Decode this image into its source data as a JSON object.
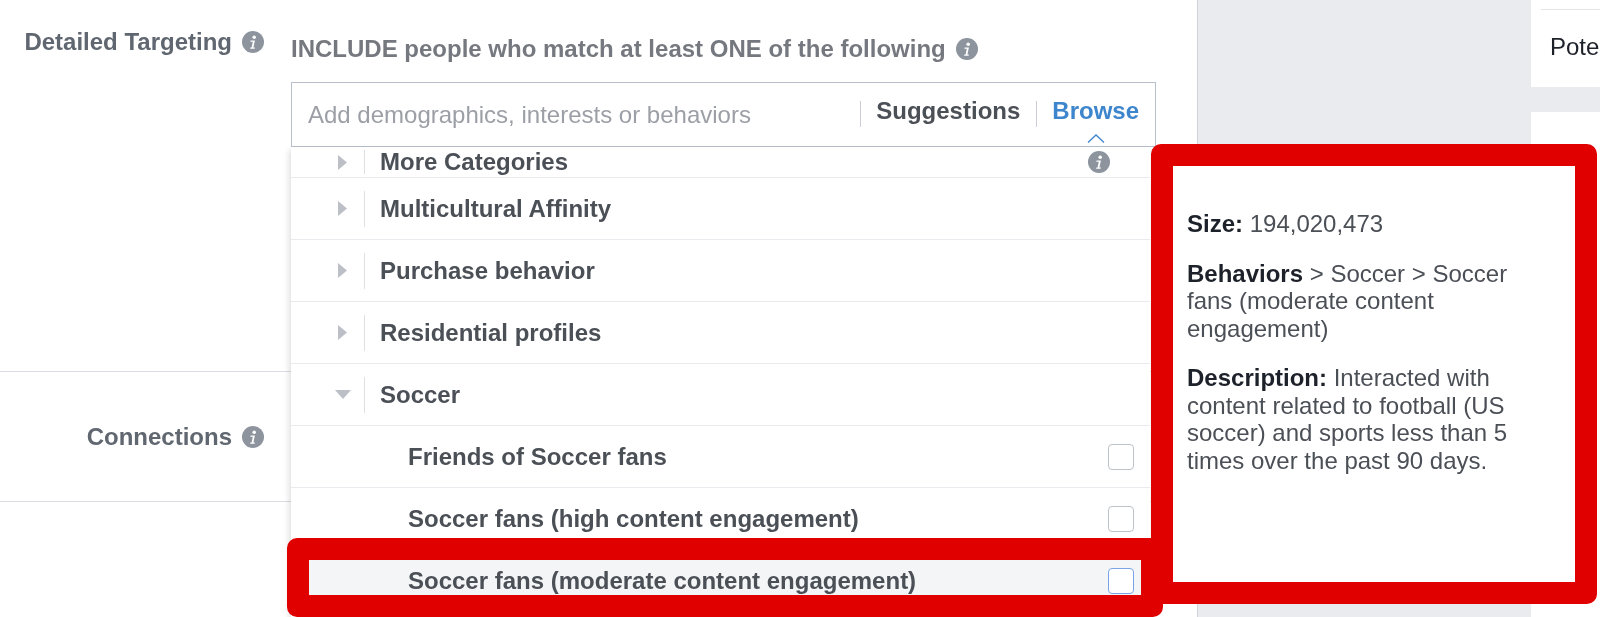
{
  "targeting": {
    "label": "Detailed Targeting",
    "heading": "INCLUDE people who match at least ONE of the following",
    "search": {
      "placeholder": "Add demographics, interests or behaviors"
    },
    "tabs": [
      {
        "label": "Suggestions",
        "selected": false
      },
      {
        "label": "Browse",
        "selected": true
      }
    ]
  },
  "browse_list": [
    {
      "label": "More Categories",
      "expanded": false,
      "info_icon": true
    },
    {
      "label": "Multicultural Affinity",
      "expanded": false,
      "info_icon": false
    },
    {
      "label": "Purchase behavior",
      "expanded": false,
      "info_icon": false
    },
    {
      "label": "Residential profiles",
      "expanded": false,
      "info_icon": false
    },
    {
      "label": "Soccer",
      "expanded": true,
      "info_icon": false,
      "children": [
        {
          "label": "Friends of Soccer fans",
          "checked": false,
          "highlighted": false,
          "outlined": false
        },
        {
          "label": "Soccer fans (high content engagement)",
          "checked": false,
          "highlighted": false,
          "outlined": false
        },
        {
          "label": "Soccer fans (moderate content engagement)",
          "checked": false,
          "highlighted": true,
          "outlined": true
        }
      ]
    }
  ],
  "connections": {
    "label": "Connections"
  },
  "tooltip": {
    "outlined": true,
    "size": "**Size:** 194,020,473",
    "path": "**Behaviors** > Soccer > Soccer fans (moderate content engagement)",
    "description": "**Description:** Interacted with content related to football (US soccer) and sports less than 5 times over the past 90 days."
  },
  "side_panel": {
    "text": "Pote"
  }
}
